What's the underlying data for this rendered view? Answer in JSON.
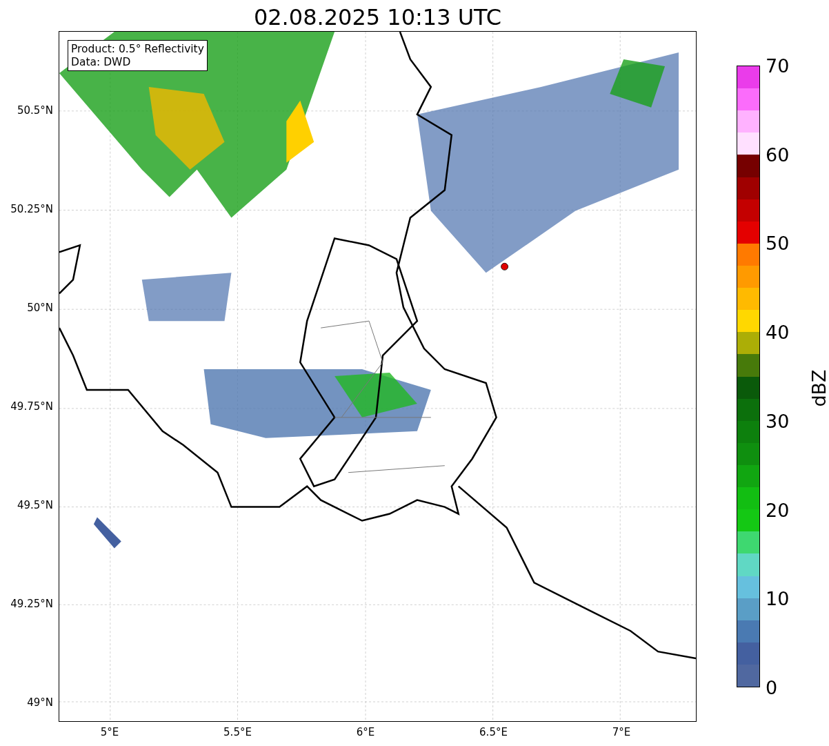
{
  "title": "02.08.2025 10:13 UTC",
  "info_box": {
    "lines": [
      "Product: 0.5° Reflectivity",
      "Data: DWD"
    ]
  },
  "y_axis": {
    "ticks": [
      "50.5°N",
      "50.25°N",
      "50°N",
      "49.75°N",
      "49.5°N",
      "49.25°N",
      "49°N"
    ]
  },
  "x_axis": {
    "ticks": [
      "5°E",
      "5.5°E",
      "6°E",
      "6.5°E",
      "7°E"
    ]
  },
  "colorbar": {
    "ticks": [
      "70",
      "60",
      "50",
      "40",
      "30",
      "20",
      "10",
      "0"
    ],
    "label": "dBZ"
  }
}
